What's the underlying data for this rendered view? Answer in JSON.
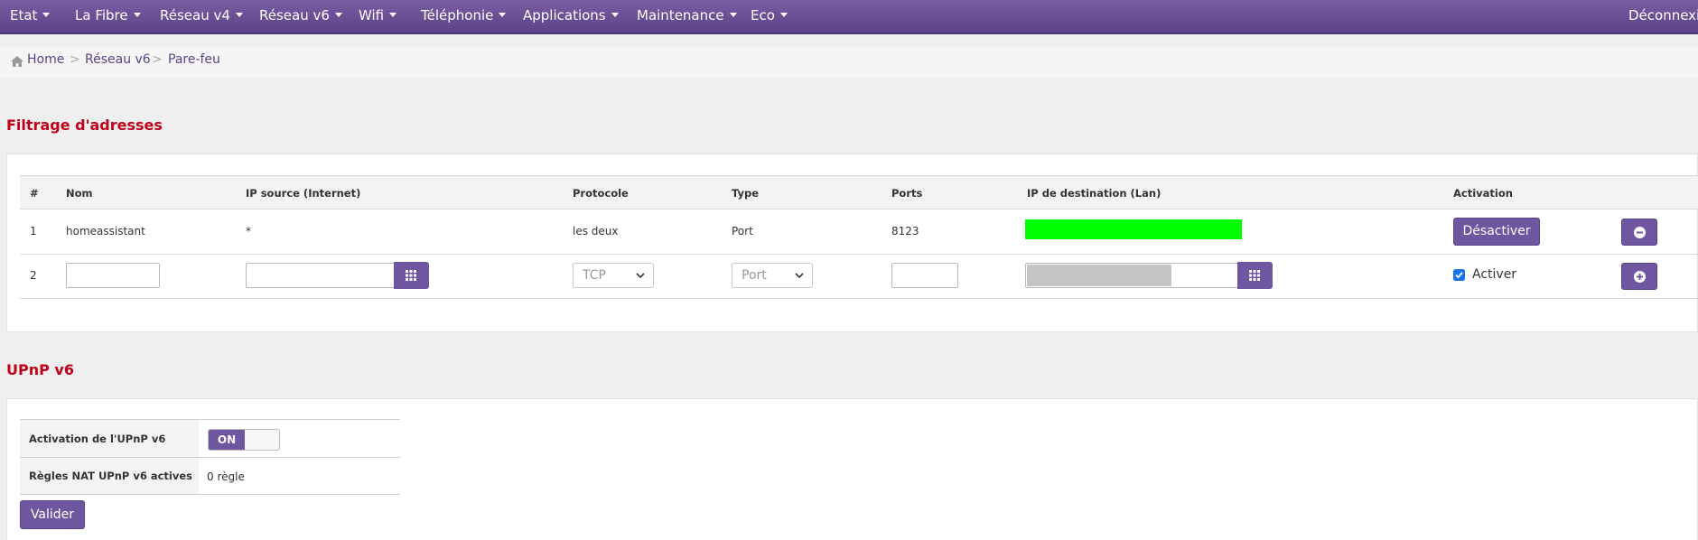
{
  "nav": {
    "items": [
      {
        "label": "Etat",
        "dropdown": true
      },
      {
        "label": "La Fibre",
        "dropdown": true
      },
      {
        "label": "Réseau v4",
        "dropdown": true
      },
      {
        "label": "Réseau v6",
        "dropdown": true
      },
      {
        "label": "Wifi",
        "dropdown": true
      },
      {
        "label": "Téléphonie",
        "dropdown": true
      },
      {
        "label": "Applications",
        "dropdown": true
      },
      {
        "label": "Maintenance",
        "dropdown": true
      },
      {
        "label": "Eco",
        "dropdown": true
      }
    ],
    "logout_label": "Déconnexio"
  },
  "breadcrumb": {
    "home": "Home",
    "level1": "Réseau v6",
    "level2": "Pare-feu",
    "separator": ">"
  },
  "filtering": {
    "title": "Filtrage d'adresses",
    "columns": {
      "num": "#",
      "name": "Nom",
      "source": "IP source (Internet)",
      "protocol": "Protocole",
      "type": "Type",
      "ports": "Ports",
      "dest": "IP de destination (Lan)",
      "activation": "Activation"
    },
    "rows": [
      {
        "num": "1",
        "name": "homeassistant",
        "source": "*",
        "protocol": "les deux",
        "type": "Port",
        "ports": "8123",
        "dest_highlight_color": "#00ff00",
        "action_label": "Désactiver"
      }
    ],
    "new_row": {
      "num": "2",
      "protocol_selected": "TCP",
      "type_selected": "Port",
      "activate_label": "Activer",
      "activate_checked": true
    }
  },
  "upnp": {
    "title": "UPnP v6",
    "activation_label": "Activation de l'UPnP v6",
    "toggle_label": "ON",
    "rules_label": "Règles NAT UPnP v6 actives",
    "rules_value": "0 règle",
    "submit_label": "Valider"
  },
  "colors": {
    "accent": "#6f56a0",
    "heading": "#c0001a",
    "nav": "#6a4f96"
  }
}
